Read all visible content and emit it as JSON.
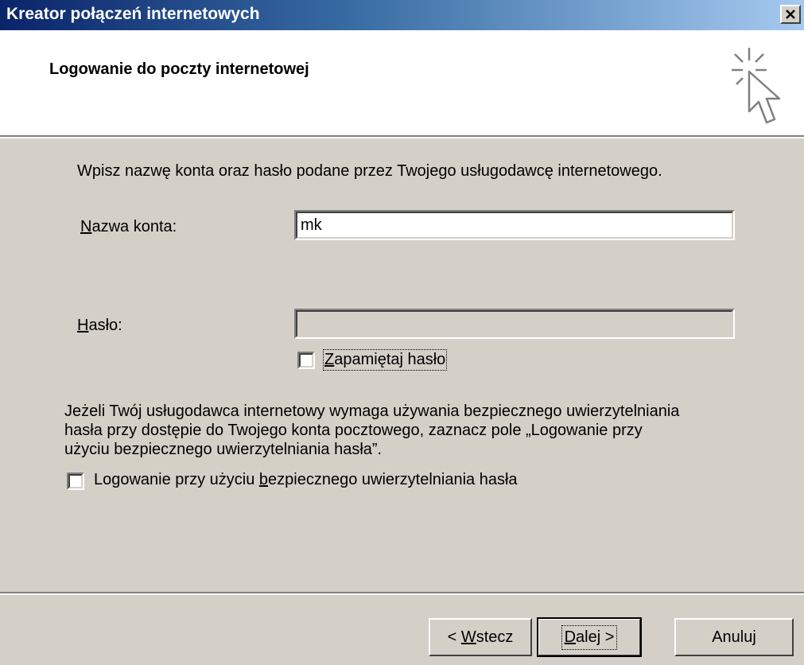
{
  "window": {
    "title": "Kreator połączeń internetowych"
  },
  "header": {
    "title": "Logowanie do poczty internetowej",
    "icon": "wizard-cursor-icon"
  },
  "content": {
    "instruction": "Wpisz nazwę konta oraz hasło podane przez Twojego usługodawcę internetowego.",
    "account_label_key": "N",
    "account_label_rest": "azwa konta:",
    "account_value": "mk",
    "password_label_key": "H",
    "password_label_rest": "asło:",
    "password_value": "",
    "remember_key": "Z",
    "remember_rest": "apamiętaj hasło",
    "remember_checked": false,
    "spa_text_line1": "Jeżeli Twój usługodawca internetowy wymaga używania bezpiecznego uwierzytelniania",
    "spa_text_line2": "hasła przy dostępie do Twojego konta pocztowego, zaznacz pole „Logowanie przy",
    "spa_text_line3": "użyciu bezpiecznego uwierzytelniania hasła”.",
    "spa_label_pre": "Logowanie przy użyciu ",
    "spa_label_key": "b",
    "spa_label_post": "ezpiecznego uwierzytelniania hasła",
    "spa_checked": false
  },
  "buttons": {
    "back_pre": "< ",
    "back_key": "W",
    "back_post": "stecz",
    "next_key": "D",
    "next_post": "alej >",
    "cancel": "Anuluj"
  }
}
